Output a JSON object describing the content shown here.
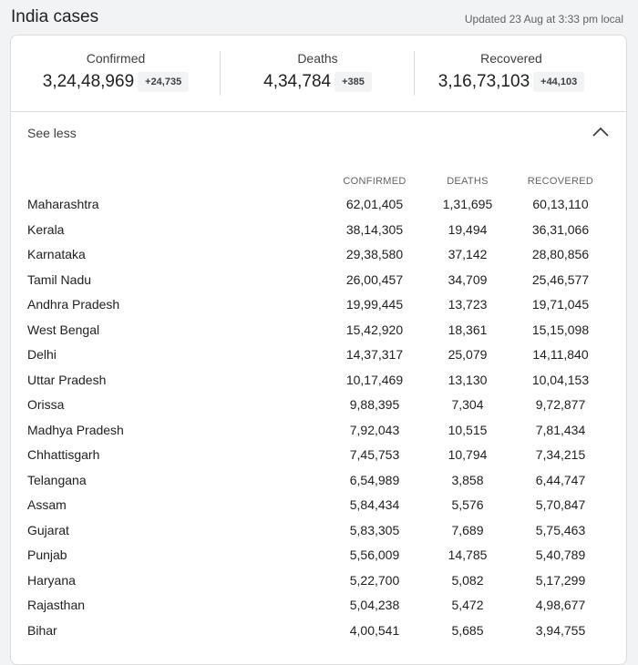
{
  "header": {
    "title": "India cases",
    "updated": "Updated 23 Aug at 3:33 pm local"
  },
  "summary": {
    "confirmed": {
      "label": "Confirmed",
      "value": "3,24,48,969",
      "delta": "+24,735"
    },
    "deaths": {
      "label": "Deaths",
      "value": "4,34,784",
      "delta": "+385"
    },
    "recovered": {
      "label": "Recovered",
      "value": "3,16,73,103",
      "delta": "+44,103"
    }
  },
  "toggle": {
    "label": "See less",
    "icon": "chevron-up-icon"
  },
  "table": {
    "columns": [
      "CONFIRMED",
      "DEATHS",
      "RECOVERED"
    ],
    "rows": [
      {
        "state": "Maharashtra",
        "confirmed": "62,01,405",
        "deaths": "1,31,695",
        "recovered": "60,13,110"
      },
      {
        "state": "Kerala",
        "confirmed": "38,14,305",
        "deaths": "19,494",
        "recovered": "36,31,066"
      },
      {
        "state": "Karnataka",
        "confirmed": "29,38,580",
        "deaths": "37,142",
        "recovered": "28,80,856"
      },
      {
        "state": "Tamil Nadu",
        "confirmed": "26,00,457",
        "deaths": "34,709",
        "recovered": "25,46,577"
      },
      {
        "state": "Andhra Pradesh",
        "confirmed": "19,99,445",
        "deaths": "13,723",
        "recovered": "19,71,045"
      },
      {
        "state": "West Bengal",
        "confirmed": "15,42,920",
        "deaths": "18,361",
        "recovered": "15,15,098"
      },
      {
        "state": "Delhi",
        "confirmed": "14,37,317",
        "deaths": "25,079",
        "recovered": "14,11,840"
      },
      {
        "state": "Uttar Pradesh",
        "confirmed": "10,17,469",
        "deaths": "13,130",
        "recovered": "10,04,153"
      },
      {
        "state": "Orissa",
        "confirmed": "9,88,395",
        "deaths": "7,304",
        "recovered": "9,72,877"
      },
      {
        "state": "Madhya Pradesh",
        "confirmed": "7,92,043",
        "deaths": "10,515",
        "recovered": "7,81,434"
      },
      {
        "state": "Chhattisgarh",
        "confirmed": "7,45,753",
        "deaths": "10,794",
        "recovered": "7,34,215"
      },
      {
        "state": "Telangana",
        "confirmed": "6,54,989",
        "deaths": "3,858",
        "recovered": "6,44,747"
      },
      {
        "state": "Assam",
        "confirmed": "5,84,434",
        "deaths": "5,576",
        "recovered": "5,70,847"
      },
      {
        "state": "Gujarat",
        "confirmed": "5,83,305",
        "deaths": "7,689",
        "recovered": "5,75,463"
      },
      {
        "state": "Punjab",
        "confirmed": "5,56,009",
        "deaths": "14,785",
        "recovered": "5,40,789"
      },
      {
        "state": "Haryana",
        "confirmed": "5,22,700",
        "deaths": "5,082",
        "recovered": "5,17,299"
      },
      {
        "state": "Rajasthan",
        "confirmed": "5,04,238",
        "deaths": "5,472",
        "recovered": "4,98,677"
      },
      {
        "state": "Bihar",
        "confirmed": "4,00,541",
        "deaths": "5,685",
        "recovered": "3,94,755"
      }
    ]
  }
}
